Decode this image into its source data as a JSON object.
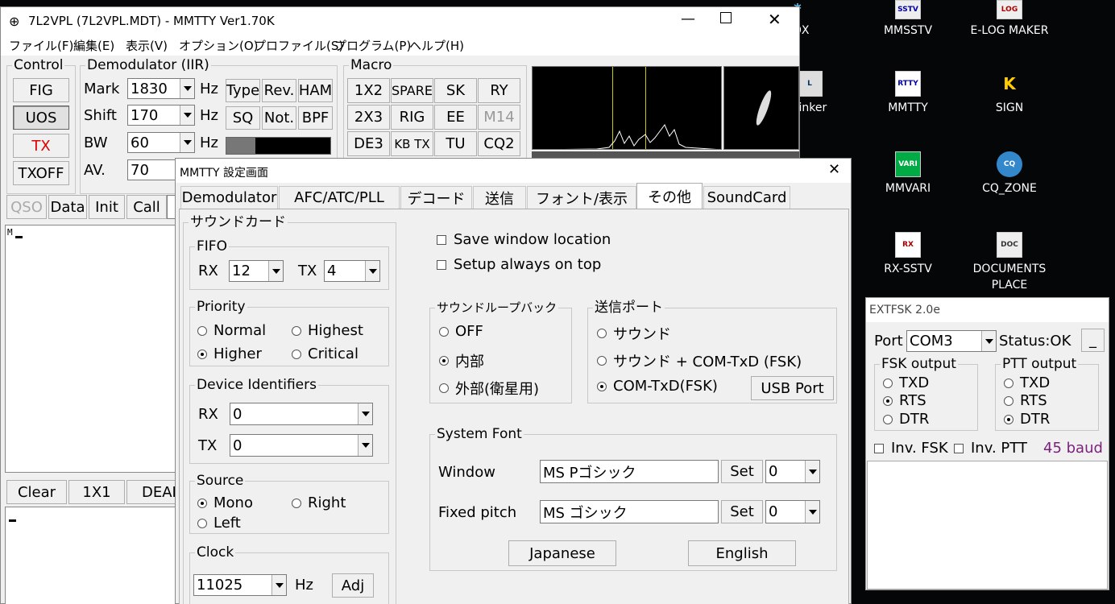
{
  "desktop": {
    "icons": [
      {
        "label": "TDX",
        "glyph": "*"
      },
      {
        "label": "MMSSTV",
        "glyph": "SSTV"
      },
      {
        "label": "E-LOG MAKER",
        "glyph": "LOG"
      },
      {
        "label": "Linker",
        "glyph": "L"
      },
      {
        "label": "MMTTY",
        "glyph": "RTTY"
      },
      {
        "label": "SIGN",
        "glyph": "K"
      },
      {
        "label": "MMVARI",
        "glyph": "VARI"
      },
      {
        "label": "CQ_ZONE",
        "glyph": "CQ"
      },
      {
        "label": "RX-SSTV",
        "glyph": "RX"
      },
      {
        "label": "DOCUMENTS",
        "glyph": "DOC"
      },
      {
        "label": "PLACE",
        "glyph": ""
      }
    ]
  },
  "main": {
    "title": "7L2VPL (7L2VPL.MDT) - MMTTY Ver1.70K",
    "menu": [
      "ファイル(F)",
      "編集(E)",
      "表示(V)",
      "オプション(O)",
      "プロファイル(S)",
      "プログラム(P)",
      "ヘルプ(H)"
    ],
    "control": {
      "label": "Control",
      "buttons": [
        "FIG",
        "UOS",
        "TX",
        "TXOFF"
      ]
    },
    "demod": {
      "label": "Demodulator (IIR)",
      "rows": [
        {
          "name": "Mark",
          "value": "1830",
          "unit": "Hz"
        },
        {
          "name": "Shift",
          "value": "170",
          "unit": "Hz"
        },
        {
          "name": "BW",
          "value": "60",
          "unit": "Hz"
        },
        {
          "name": "AV.",
          "value": "70",
          "unit": ""
        }
      ],
      "buttons": [
        "Type",
        "Rev.",
        "HAM",
        "SQ",
        "Not.",
        "BPF"
      ]
    },
    "macro": {
      "label": "Macro",
      "buttons": [
        "1X2",
        "SPARE",
        "SK",
        "RY",
        "2X3",
        "RIG",
        "EE",
        "M14",
        "DE3",
        "KB TX",
        "TU",
        "CQ2"
      ]
    },
    "qso_buttons": [
      "QSO",
      "Data",
      "Init",
      "Call"
    ],
    "rx_text": "M",
    "bottom_buttons": [
      "Clear",
      "1X1",
      "DEAR"
    ]
  },
  "dialog": {
    "title": "MMTTY 設定画面",
    "tabs": [
      "Demodulator",
      "AFC/ATC/PLL",
      "デコード",
      "送信",
      "フォント/表示",
      "その他",
      "SoundCard"
    ],
    "soundcard": {
      "label": "サウンドカード",
      "fifo": {
        "label": "FIFO",
        "rx_label": "RX",
        "rx": "12",
        "tx_label": "TX",
        "tx": "4"
      },
      "priority": {
        "label": "Priority",
        "options": [
          "Normal",
          "Highest",
          "Higher",
          "Critical"
        ],
        "selected": "Higher"
      },
      "device": {
        "label": "Device Identifiers",
        "rx_label": "RX",
        "rx": "0",
        "tx_label": "TX",
        "tx": "0"
      },
      "source": {
        "label": "Source",
        "options": [
          "Mono",
          "Right",
          "Left"
        ],
        "selected": "Mono"
      },
      "clock": {
        "label": "Clock",
        "value": "11025",
        "unit": "Hz",
        "adj": "Adj"
      }
    },
    "checks": [
      "Save window location",
      "Setup always on top"
    ],
    "loopback": {
      "label": "サウンドループバック",
      "options": [
        "OFF",
        "内部",
        "外部(衛星用)"
      ],
      "selected": "内部"
    },
    "txport": {
      "label": "送信ポート",
      "options": [
        "サウンド",
        "サウンド + COM-TxD (FSK)",
        "COM-TxD(FSK)"
      ],
      "selected": "COM-TxD(FSK)",
      "usb": "USB Port"
    },
    "sysfont": {
      "label": "System Font",
      "window_label": "Window",
      "window_font": "MS Pゴシック",
      "window_size": "0",
      "fixed_label": "Fixed pitch",
      "fixed_font": "MS ゴシック",
      "fixed_size": "0",
      "set": "Set",
      "japanese": "Japanese",
      "english": "English"
    }
  },
  "extfsk": {
    "title": "EXTFSK 2.0e",
    "port_label": "Port",
    "port": "COM3",
    "status": "Status:OK",
    "min": "_",
    "fsk": {
      "label": "FSK output",
      "options": [
        "TXD",
        "RTS",
        "DTR"
      ],
      "selected": "RTS"
    },
    "ptt": {
      "label": "PTT output",
      "options": [
        "TXD",
        "RTS",
        "DTR"
      ],
      "selected": "DTR"
    },
    "inv_fsk": "Inv. FSK",
    "inv_ptt": "Inv. PTT",
    "baud": "45 baud",
    "baud_color": "#7a1f7a"
  }
}
